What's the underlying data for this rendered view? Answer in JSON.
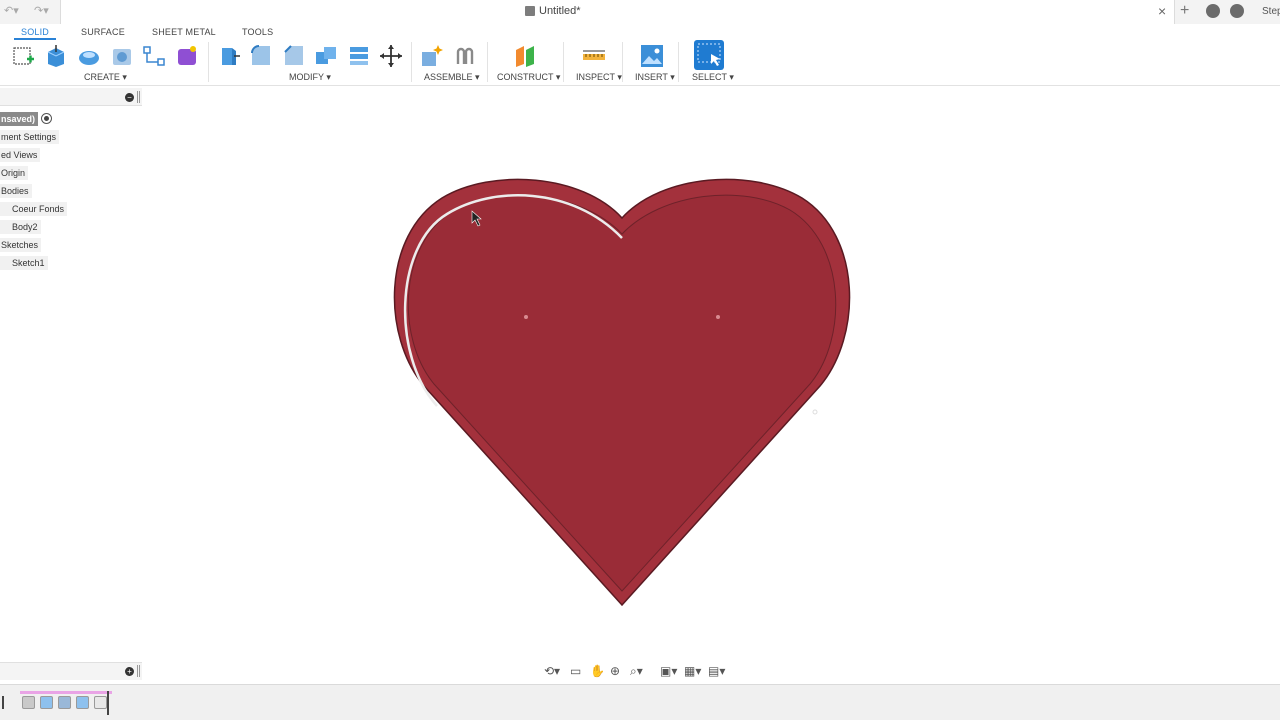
{
  "titlebar": {
    "undo_icon": "undo-icon",
    "redo_icon": "redo-icon",
    "document_title": "Untitled*",
    "close_symbol": "×",
    "new_tab_symbol": "+",
    "user_name": "Step"
  },
  "workspace_tabs": [
    "SOLID",
    "SURFACE",
    "SHEET METAL",
    "TOOLS"
  ],
  "toolbar_groups": {
    "create": "CREATE",
    "modify": "MODIFY",
    "assemble": "ASSEMBLE",
    "construct": "CONSTRUCT",
    "inspect": "INSPECT",
    "insert": "INSERT",
    "select": "SELECT"
  },
  "browser": {
    "root": "nsaved)",
    "items": [
      {
        "label": "ment Settings"
      },
      {
        "label": "ed Views"
      },
      {
        "label": "Origin"
      },
      {
        "label": "Bodies"
      },
      {
        "label": "Coeur Fonds"
      },
      {
        "label": "Body2"
      },
      {
        "label": "Sketches"
      },
      {
        "label": "Sketch1"
      }
    ]
  },
  "colors": {
    "accent": "#2a82d6",
    "heart_body": "#a3313c",
    "heart_inner": "#9a2c37",
    "timeline_highlight": "#e9a4e6"
  },
  "icons": {
    "cursor": "pointer-cursor-icon",
    "orbit": "orbit-icon",
    "pan": "pan-icon",
    "zoom": "zoom-icon",
    "display": "display-settings-icon",
    "grid": "grid-icon",
    "viewports": "viewports-icon"
  }
}
